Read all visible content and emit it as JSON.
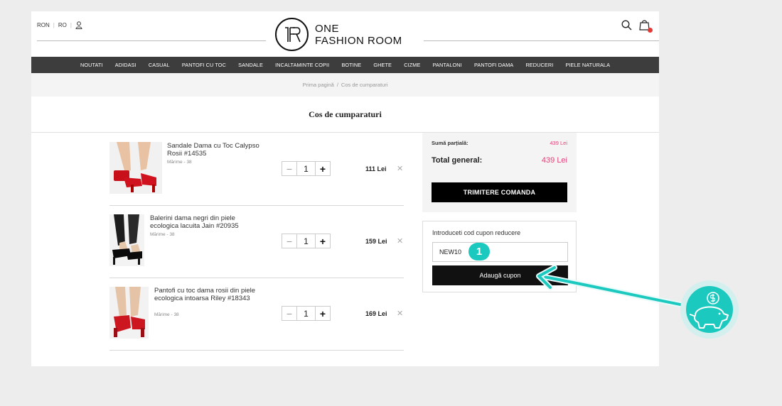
{
  "header": {
    "currency": "RON",
    "language": "RO",
    "logo_line1": "ONE",
    "logo_line2": "FASHION ROOM",
    "user_icon": "user-icon",
    "search_icon": "search-icon",
    "cart_icon": "shopping-bag-icon"
  },
  "nav": {
    "items": [
      "NOUTATI",
      "ADIDASI",
      "CASUAL",
      "PANTOFI CU TOC",
      "SANDALE",
      "INCALTAMINTE COPII",
      "BOTINE",
      "GHETE",
      "CIZME",
      "PANTALONI",
      "PANTOFI DAMA",
      "REDUCERI",
      "PIELE NATURALA"
    ]
  },
  "breadcrumb": {
    "home": "Prima pagină",
    "separator": "/",
    "current": "Cos de cumparaturi"
  },
  "page_title": "Cos de cumparaturi",
  "cart": {
    "items": [
      {
        "name": "Sandale Dama cu Toc Calypso Rosii #14535",
        "size": "Mărime - 38",
        "qty": "1",
        "price": "111 Lei"
      },
      {
        "name": "Balerini dama negri din piele ecologica lacuita Jain #20935",
        "size": "Mărime - 38",
        "qty": "1",
        "price": "159 Lei"
      },
      {
        "name": "Pantofi cu toc dama rosii din piele ecologica intoarsa Riley #18343",
        "size": "Mărime - 38",
        "qty": "1",
        "price": "169 Lei"
      }
    ],
    "minus": "−",
    "plus": "+",
    "remove": "✕"
  },
  "summary": {
    "subtotal_label": "Sumă parțială:",
    "subtotal_value": "439 Lei",
    "total_label": "Total general:",
    "total_value": "439 Lei",
    "checkout_label": "TRIMITERE COMANDA"
  },
  "coupon": {
    "title": "Introduceti cod cupon reducere",
    "value": "NEW10",
    "button_label": "Adaugă cupon",
    "step_number": "1"
  },
  "colors": {
    "accent_pink": "#e4407b",
    "teal": "#1cc9bf",
    "nav_bg": "#3d3d3d"
  }
}
